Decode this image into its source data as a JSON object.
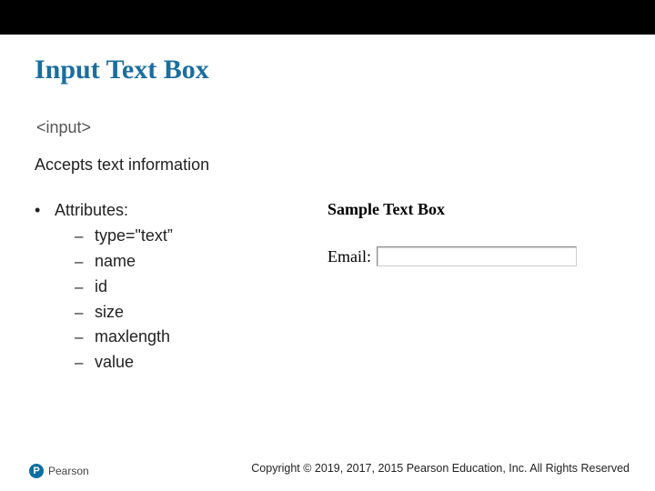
{
  "title": "Input Text Box",
  "tag": "<input>",
  "description": "Accepts text information",
  "bulletLead": "Attributes:",
  "attributes": [
    "type=\"text”",
    "name",
    "id",
    "size",
    "maxlength",
    "value"
  ],
  "sample": {
    "heading": "Sample Text Box",
    "label": "Email:"
  },
  "logo": {
    "mark": "P",
    "text": "Pearson"
  },
  "copyright": "Copyright © 2019, 2017, 2015 Pearson Education, Inc. All Rights Reserved"
}
